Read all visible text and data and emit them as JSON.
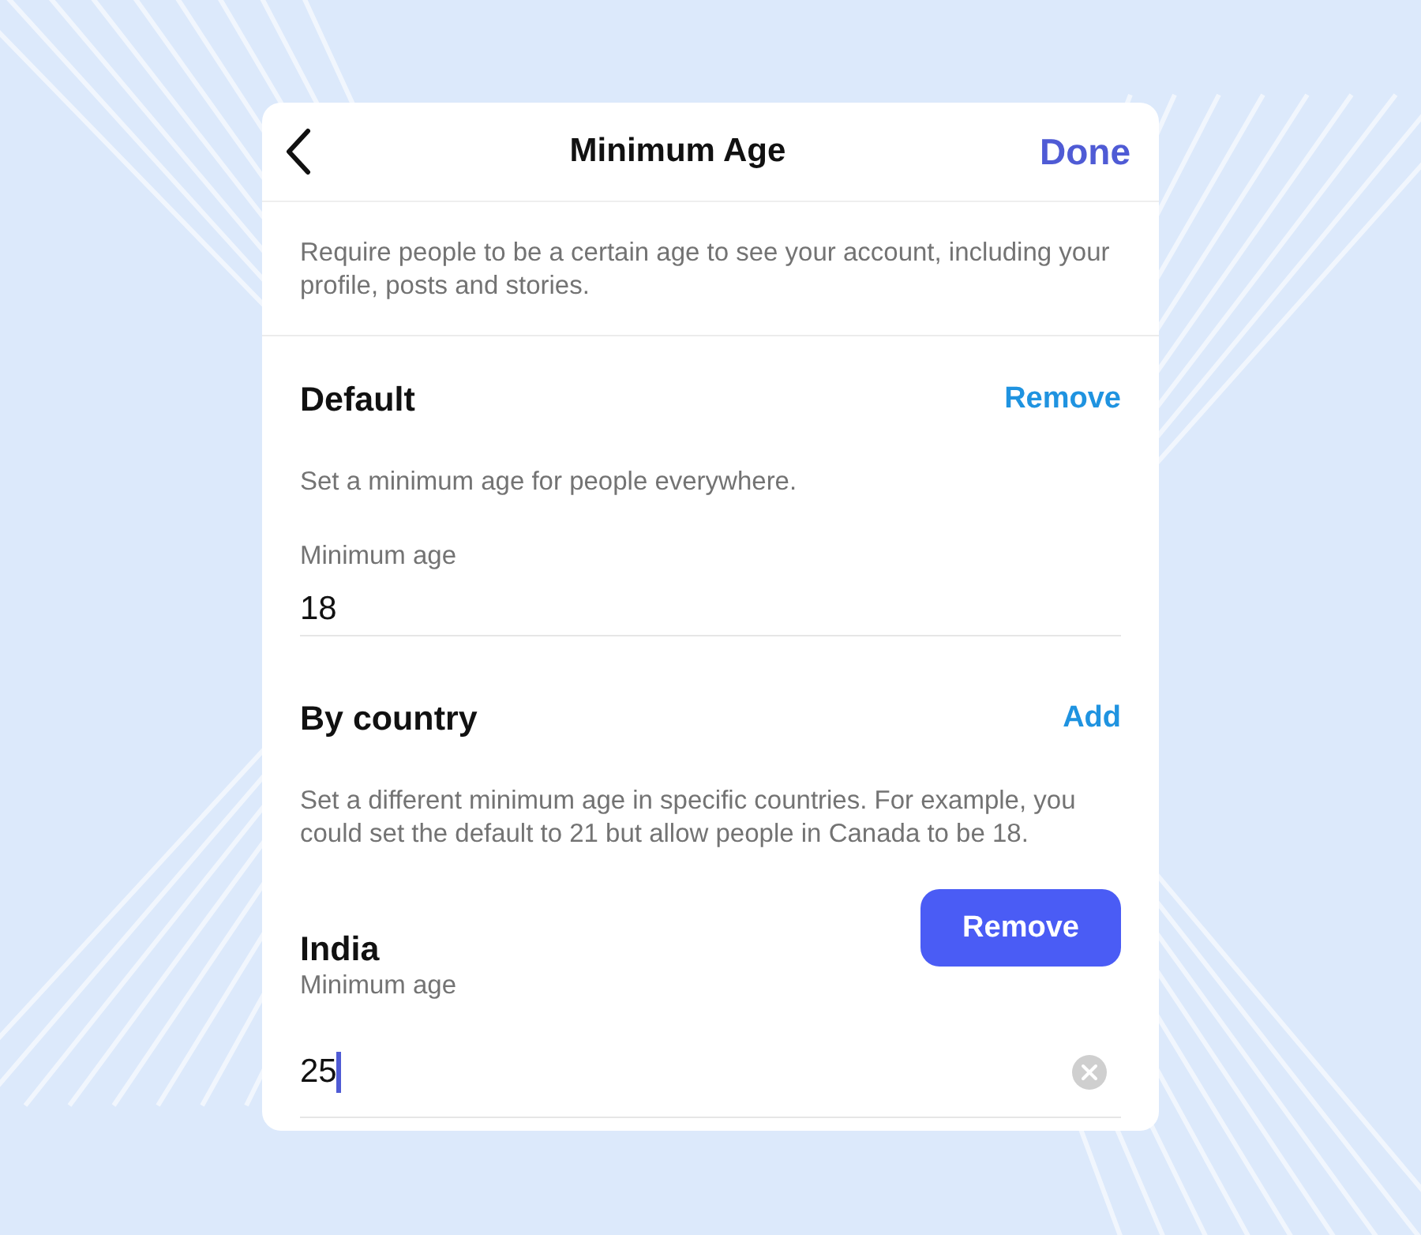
{
  "header": {
    "title": "Minimum Age",
    "action": "Done"
  },
  "intro": "Require people to be a certain age to see your account, including your profile, posts and stories.",
  "sections": [
    {
      "kind": "field",
      "title": "Default",
      "action": "Remove",
      "description": "Set a minimum age for people everywhere.",
      "field": {
        "label": "Minimum age",
        "value": "18"
      }
    },
    {
      "kind": "list",
      "title": "By country",
      "action": "Add",
      "description": "Set a different minimum age in specific countries. For example, you could set the default to 21 but allow people in Canada to be 18."
    }
  ],
  "countries": [
    {
      "name": "India",
      "button": "Remove",
      "field": {
        "label": "Minimum age",
        "value": "25",
        "focused": true
      }
    }
  ]
}
